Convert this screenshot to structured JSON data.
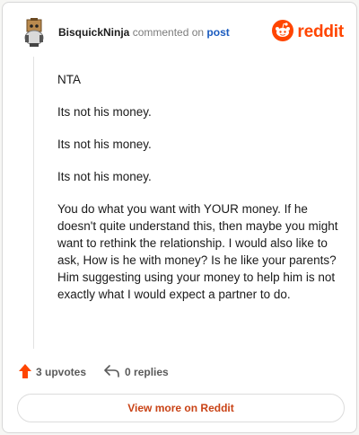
{
  "header": {
    "username": "BisquickNinja",
    "action_text": " commented on ",
    "target_text": "post",
    "brand": "reddit"
  },
  "comment": {
    "paragraphs": [
      "NTA",
      "Its not his money.",
      "Its not his money.",
      "Its not his money.",
      "You do what you want with YOUR money. If he doesn't quite understand this, then maybe you might want to rethink the relationship. I would also like to ask, How is he with money? Is he like your parents? Him suggesting using your money to help him is not exactly what I would expect a partner to do."
    ]
  },
  "actions": {
    "upvotes_label": "3 upvotes",
    "replies_label": "0 replies"
  },
  "footer": {
    "view_more_label": "View more on Reddit"
  },
  "colors": {
    "brand": "#ff4500",
    "link": "#1a5bbf",
    "button_text": "#c94316"
  },
  "icons": {
    "avatar": "snoo-avatar-icon",
    "logo": "reddit-snoo-icon",
    "upvote": "upvote-arrow-icon",
    "reply": "reply-arrow-icon"
  }
}
